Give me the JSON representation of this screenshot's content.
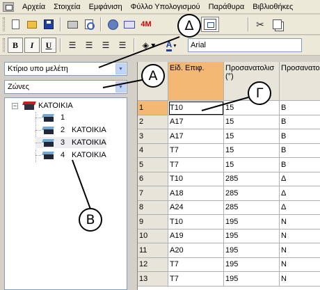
{
  "menu": {
    "items": [
      "Αρχεία",
      "Στοιχεία",
      "Εμφάνιση",
      "Φύλλο Υπολογισμού",
      "Παράθυρα",
      "Βιβλιοθήκες"
    ]
  },
  "toolbar": {
    "bold": "B",
    "italic": "I",
    "underline": "U",
    "mode_4m": "4M",
    "font_name": "Arial",
    "text_color": "A"
  },
  "selectors": {
    "building": "Κτίριο υπο μελέτη",
    "category": "Ζώνες"
  },
  "tree": {
    "root": "ΚΑΤΟΙΚΙΑ",
    "children": [
      {
        "num": "1",
        "name": ""
      },
      {
        "num": "2",
        "name": "ΚΑΤΟΙΚΙΑ"
      },
      {
        "num": "3",
        "name": "ΚΑΤΟΙΚΙΑ"
      },
      {
        "num": "4",
        "name": "ΚΑΤΟΙΚΙΑ"
      }
    ]
  },
  "grid": {
    "headers": [
      "Είδ. Επιφ.",
      "Προσανατολισ (°)",
      "Προσανατο"
    ],
    "rows": [
      {
        "n": "1",
        "type": "T10",
        "angle": "15",
        "dir": "B"
      },
      {
        "n": "2",
        "type": "A17",
        "angle": "15",
        "dir": "B"
      },
      {
        "n": "3",
        "type": "A17",
        "angle": "15",
        "dir": "B"
      },
      {
        "n": "4",
        "type": "T7",
        "angle": "15",
        "dir": "B"
      },
      {
        "n": "5",
        "type": "T7",
        "angle": "15",
        "dir": "B"
      },
      {
        "n": "6",
        "type": "T10",
        "angle": "285",
        "dir": "Δ"
      },
      {
        "n": "7",
        "type": "A18",
        "angle": "285",
        "dir": "Δ"
      },
      {
        "n": "8",
        "type": "A24",
        "angle": "285",
        "dir": "Δ"
      },
      {
        "n": "9",
        "type": "T10",
        "angle": "195",
        "dir": "N"
      },
      {
        "n": "10",
        "type": "A19",
        "angle": "195",
        "dir": "N"
      },
      {
        "n": "11",
        "type": "A20",
        "angle": "195",
        "dir": "N"
      },
      {
        "n": "12",
        "type": "T7",
        "angle": "195",
        "dir": "N"
      },
      {
        "n": "13",
        "type": "T7",
        "angle": "195",
        "dir": "N"
      }
    ]
  },
  "callouts": {
    "delta": "Δ",
    "alpha": "A",
    "gamma": "Γ",
    "beta": "B"
  },
  "colors": {
    "selected_header": "#f3b873",
    "chrome": "#ece9d8"
  }
}
